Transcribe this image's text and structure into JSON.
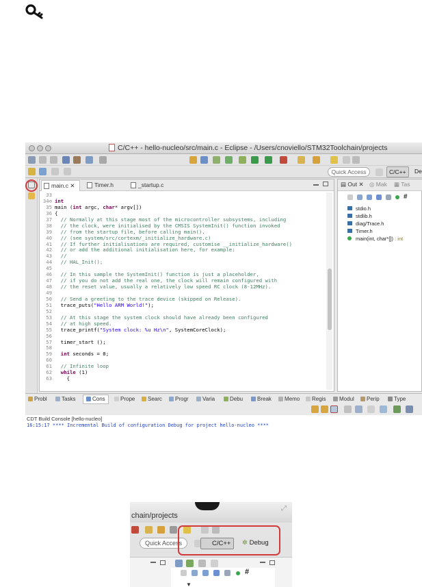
{
  "window": {
    "title": "C/C++ - hello-nucleo/src/main.c - Eclipse - /Users/cnoviello/STM32Toolchain/projects"
  },
  "toolbar": {
    "quick_access": "Quick Access",
    "perspective_cc": "C/C++",
    "perspective_debug_partial": "De"
  },
  "editor": {
    "tabs": [
      {
        "label": "main.c"
      },
      {
        "label": "Timer.h"
      },
      {
        "label": "_startup.c"
      }
    ],
    "lines": [
      {
        "n": "33",
        "segs": []
      },
      {
        "n": "34⊖",
        "segs": [
          {
            "t": "int",
            "c": "kw"
          }
        ]
      },
      {
        "n": "35",
        "segs": [
          {
            "t": "main (",
            "c": "pl"
          },
          {
            "t": "int",
            "c": "kw"
          },
          {
            "t": " argc, ",
            "c": "pl"
          },
          {
            "t": "char",
            "c": "kw"
          },
          {
            "t": "* argv[])",
            "c": "pl"
          }
        ]
      },
      {
        "n": "36",
        "segs": [
          {
            "t": "{",
            "c": "pl"
          }
        ]
      },
      {
        "n": "37",
        "segs": [
          {
            "t": "  // Normally at this stage most of the microcontroller subsystems, including",
            "c": "cm"
          }
        ]
      },
      {
        "n": "38",
        "segs": [
          {
            "t": "  // the clock, were initialised by the CMSIS SystemInit() function invoked",
            "c": "cm"
          }
        ]
      },
      {
        "n": "39",
        "segs": [
          {
            "t": "  // from the startup file, before calling main().",
            "c": "cm"
          }
        ]
      },
      {
        "n": "40",
        "segs": [
          {
            "t": "  // (see system/src/cortexm/_initialize_hardware.c)",
            "c": "cm"
          }
        ]
      },
      {
        "n": "41",
        "segs": [
          {
            "t": "  // If further initialisations are required, customise __initialize_hardware()",
            "c": "cm"
          }
        ]
      },
      {
        "n": "42",
        "segs": [
          {
            "t": "  // or add the additional initialisation here, for example:",
            "c": "cm"
          }
        ]
      },
      {
        "n": "43",
        "segs": [
          {
            "t": "  //",
            "c": "cm"
          }
        ]
      },
      {
        "n": "44",
        "segs": [
          {
            "t": "  // HAL_Init();",
            "c": "cm"
          }
        ]
      },
      {
        "n": "45",
        "segs": []
      },
      {
        "n": "46",
        "segs": [
          {
            "t": "  // In this sample the SystemInit() function is just a placeholder,",
            "c": "cm"
          }
        ]
      },
      {
        "n": "47",
        "segs": [
          {
            "t": "  // if you do not add the real one, the clock will remain configured with",
            "c": "cm"
          }
        ]
      },
      {
        "n": "48",
        "segs": [
          {
            "t": "  // the reset value, usually a relatively low speed RC clock (8-12MHz).",
            "c": "cm"
          }
        ]
      },
      {
        "n": "49",
        "segs": []
      },
      {
        "n": "50",
        "segs": [
          {
            "t": "  // Send a greeting to the trace device (skipped on Release).",
            "c": "cm"
          }
        ]
      },
      {
        "n": "51",
        "segs": [
          {
            "t": "  trace_puts(",
            "c": "pl"
          },
          {
            "t": "\"Hello ARM World!\"",
            "c": "st"
          },
          {
            "t": ");",
            "c": "pl"
          }
        ]
      },
      {
        "n": "52",
        "segs": []
      },
      {
        "n": "53",
        "segs": [
          {
            "t": "  // At this stage the system clock should have already been configured",
            "c": "cm"
          }
        ]
      },
      {
        "n": "54",
        "segs": [
          {
            "t": "  // at high speed.",
            "c": "cm"
          }
        ]
      },
      {
        "n": "55",
        "segs": [
          {
            "t": "  trace_printf(",
            "c": "pl"
          },
          {
            "t": "\"System clock: %u Hz\\n\"",
            "c": "st"
          },
          {
            "t": ", SystemCoreClock);",
            "c": "pl"
          }
        ]
      },
      {
        "n": "56",
        "segs": []
      },
      {
        "n": "57",
        "segs": [
          {
            "t": "  timer_start ();",
            "c": "pl"
          }
        ]
      },
      {
        "n": "58",
        "segs": []
      },
      {
        "n": "59",
        "segs": [
          {
            "t": "  ",
            "c": "pl"
          },
          {
            "t": "int",
            "c": "kw"
          },
          {
            "t": " seconds = 0;",
            "c": "pl"
          }
        ]
      },
      {
        "n": "60",
        "segs": []
      },
      {
        "n": "61",
        "segs": [
          {
            "t": "  // Infinite loop",
            "c": "cm"
          }
        ]
      },
      {
        "n": "62",
        "segs": [
          {
            "t": "  ",
            "c": "pl"
          },
          {
            "t": "while",
            "c": "kw"
          },
          {
            "t": " (1)",
            "c": "pl"
          }
        ]
      },
      {
        "n": "63",
        "segs": [
          {
            "t": "    {",
            "c": "pl"
          }
        ]
      }
    ]
  },
  "outline": {
    "tabs": [
      {
        "label": "Out"
      },
      {
        "label": "Mak"
      },
      {
        "label": "Tas"
      }
    ],
    "items": [
      {
        "label": "stdio.h",
        "kind": "include"
      },
      {
        "label": "stdlib.h",
        "kind": "include"
      },
      {
        "label": "diag/Trace.h",
        "kind": "include"
      },
      {
        "label": "Timer.h",
        "kind": "include"
      },
      {
        "label": "main(int, char*[])",
        "ret": " : int",
        "kind": "function"
      }
    ]
  },
  "bottom": {
    "tabs": [
      {
        "label": "Probl"
      },
      {
        "label": "Tasks"
      },
      {
        "label": "Cons"
      },
      {
        "label": "Prope"
      },
      {
        "label": "Searc"
      },
      {
        "label": "Progr"
      },
      {
        "label": "Varia"
      },
      {
        "label": "Debu"
      },
      {
        "label": "Break"
      },
      {
        "label": "Memo"
      },
      {
        "label": "Regis"
      },
      {
        "label": "Modul"
      },
      {
        "label": "Perip"
      },
      {
        "label": "Type"
      }
    ],
    "console_label": "CDT Build Console [hello-nucleo]",
    "console_line": "16:15:17 **** Incremental Build of configuration Debug for project hello-nucleo ****"
  },
  "inset": {
    "title_fragment": "chain/projects",
    "quick_access": "Quick Access",
    "cc_button": "C/C++",
    "debug_button": "Debug"
  },
  "colors": {
    "highlight_red": "#d23a3a",
    "comment_green": "#3f7f5f",
    "keyword_purple": "#7f0055",
    "string_blue": "#2a00ff"
  }
}
